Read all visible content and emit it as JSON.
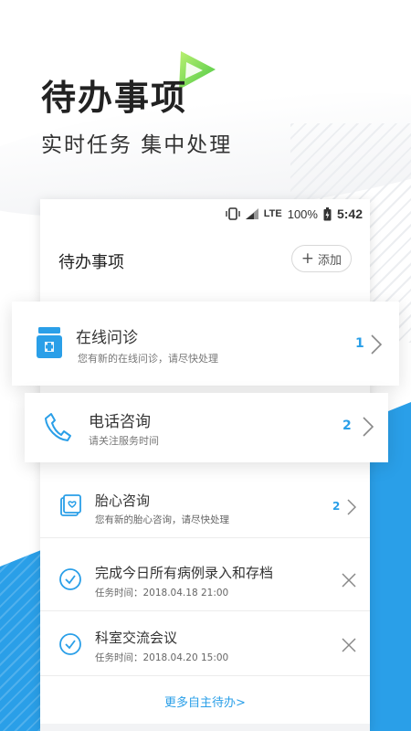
{
  "hero": {
    "title": "待办事项",
    "subtitle": "实时任务 集中处理"
  },
  "status_bar": {
    "icons": [
      "vibrate-icon",
      "signal-icon"
    ],
    "network": "LTE",
    "battery": "100%",
    "time": "5:42"
  },
  "page": {
    "title": "待办事项",
    "add_label": "添加",
    "add_icon": "plus-icon"
  },
  "cards": [
    {
      "icon": "medicine-box-icon",
      "title": "在线问诊",
      "desc": "您有新的在线问诊，请尽快处理",
      "count": "1"
    },
    {
      "icon": "phone-icon",
      "title": "电话咨询",
      "desc": "请关注服务时间",
      "count": "2"
    }
  ],
  "list": [
    {
      "icon": "fetal-heart-icon",
      "title": "胎心咨询",
      "sub": "您有新的胎心咨询，请尽快处理",
      "count": "2",
      "action": "chevron-right-icon"
    },
    {
      "icon": "check-circle-icon",
      "title": "完成今日所有病例录入和存档",
      "sub": "任务时间：2018.04.18 21:00",
      "action": "close-icon"
    },
    {
      "icon": "check-circle-icon",
      "title": "科室交流会议",
      "sub": "任务时间：2018.04.20 15:00",
      "action": "close-icon"
    }
  ],
  "more_link": "更多自主待办>",
  "colors": {
    "accent": "#2a9fe8",
    "triangle": "#6fd43f"
  }
}
